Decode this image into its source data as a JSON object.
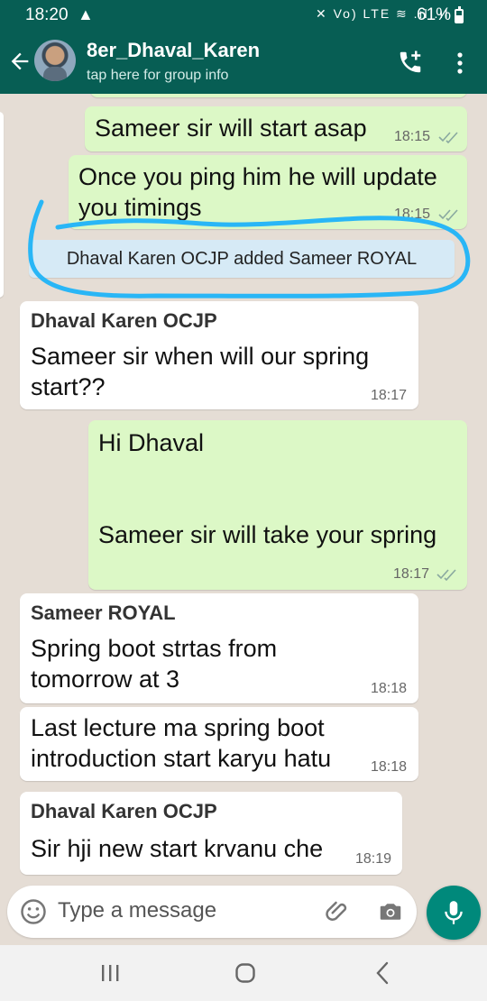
{
  "status_bar": {
    "time": "18:20",
    "warning": "▲",
    "indicators": "✕ Vo) LTE ≋ .ıl .ıl",
    "battery": "61%"
  },
  "header": {
    "title": "8er_Dhaval_Karen",
    "subtitle": "tap here for group info"
  },
  "messages": [
    {
      "type": "out",
      "text": "Sameer sir will start asap",
      "time": "18:15"
    },
    {
      "type": "out",
      "text": "Once you ping him he will update\nyou timings",
      "time": "18:15"
    },
    {
      "type": "system",
      "text": "Dhaval Karen OCJP added Sameer ROYAL"
    },
    {
      "type": "in",
      "sender": "Dhaval Karen OCJP",
      "text": "Sameer sir when will our spring\nstart??",
      "time": "18:17"
    },
    {
      "type": "out",
      "text": "Hi Dhaval\n\n\nSameer sir will take your spring",
      "time": "18:17"
    },
    {
      "type": "in",
      "sender": "Sameer ROYAL",
      "text": "Spring boot strtas from\ntomorrow  at 3",
      "time": "18:18"
    },
    {
      "type": "in",
      "text": "Last lecture ma spring boot\nintroduction start karyu hatu",
      "time": "18:18"
    },
    {
      "type": "in",
      "sender": "Dhaval Karen OCJP",
      "text": "Sir hji new start krvanu che",
      "time": "18:19"
    }
  ],
  "compose": {
    "placeholder": "Type a message"
  },
  "colors": {
    "header": "#075e54",
    "outgoing": "#dcf8c6",
    "incoming": "#ffffff",
    "background": "#e5ddd5",
    "accent": "#00897b",
    "annotation": "#29b6f6"
  },
  "icons": [
    "back-arrow-icon",
    "avatar",
    "add-call-icon",
    "more-vert-icon",
    "read-ticks-icon",
    "emoji-icon",
    "attach-icon",
    "camera-icon",
    "mic-icon",
    "recents-icon",
    "home-icon",
    "nav-back-icon"
  ]
}
